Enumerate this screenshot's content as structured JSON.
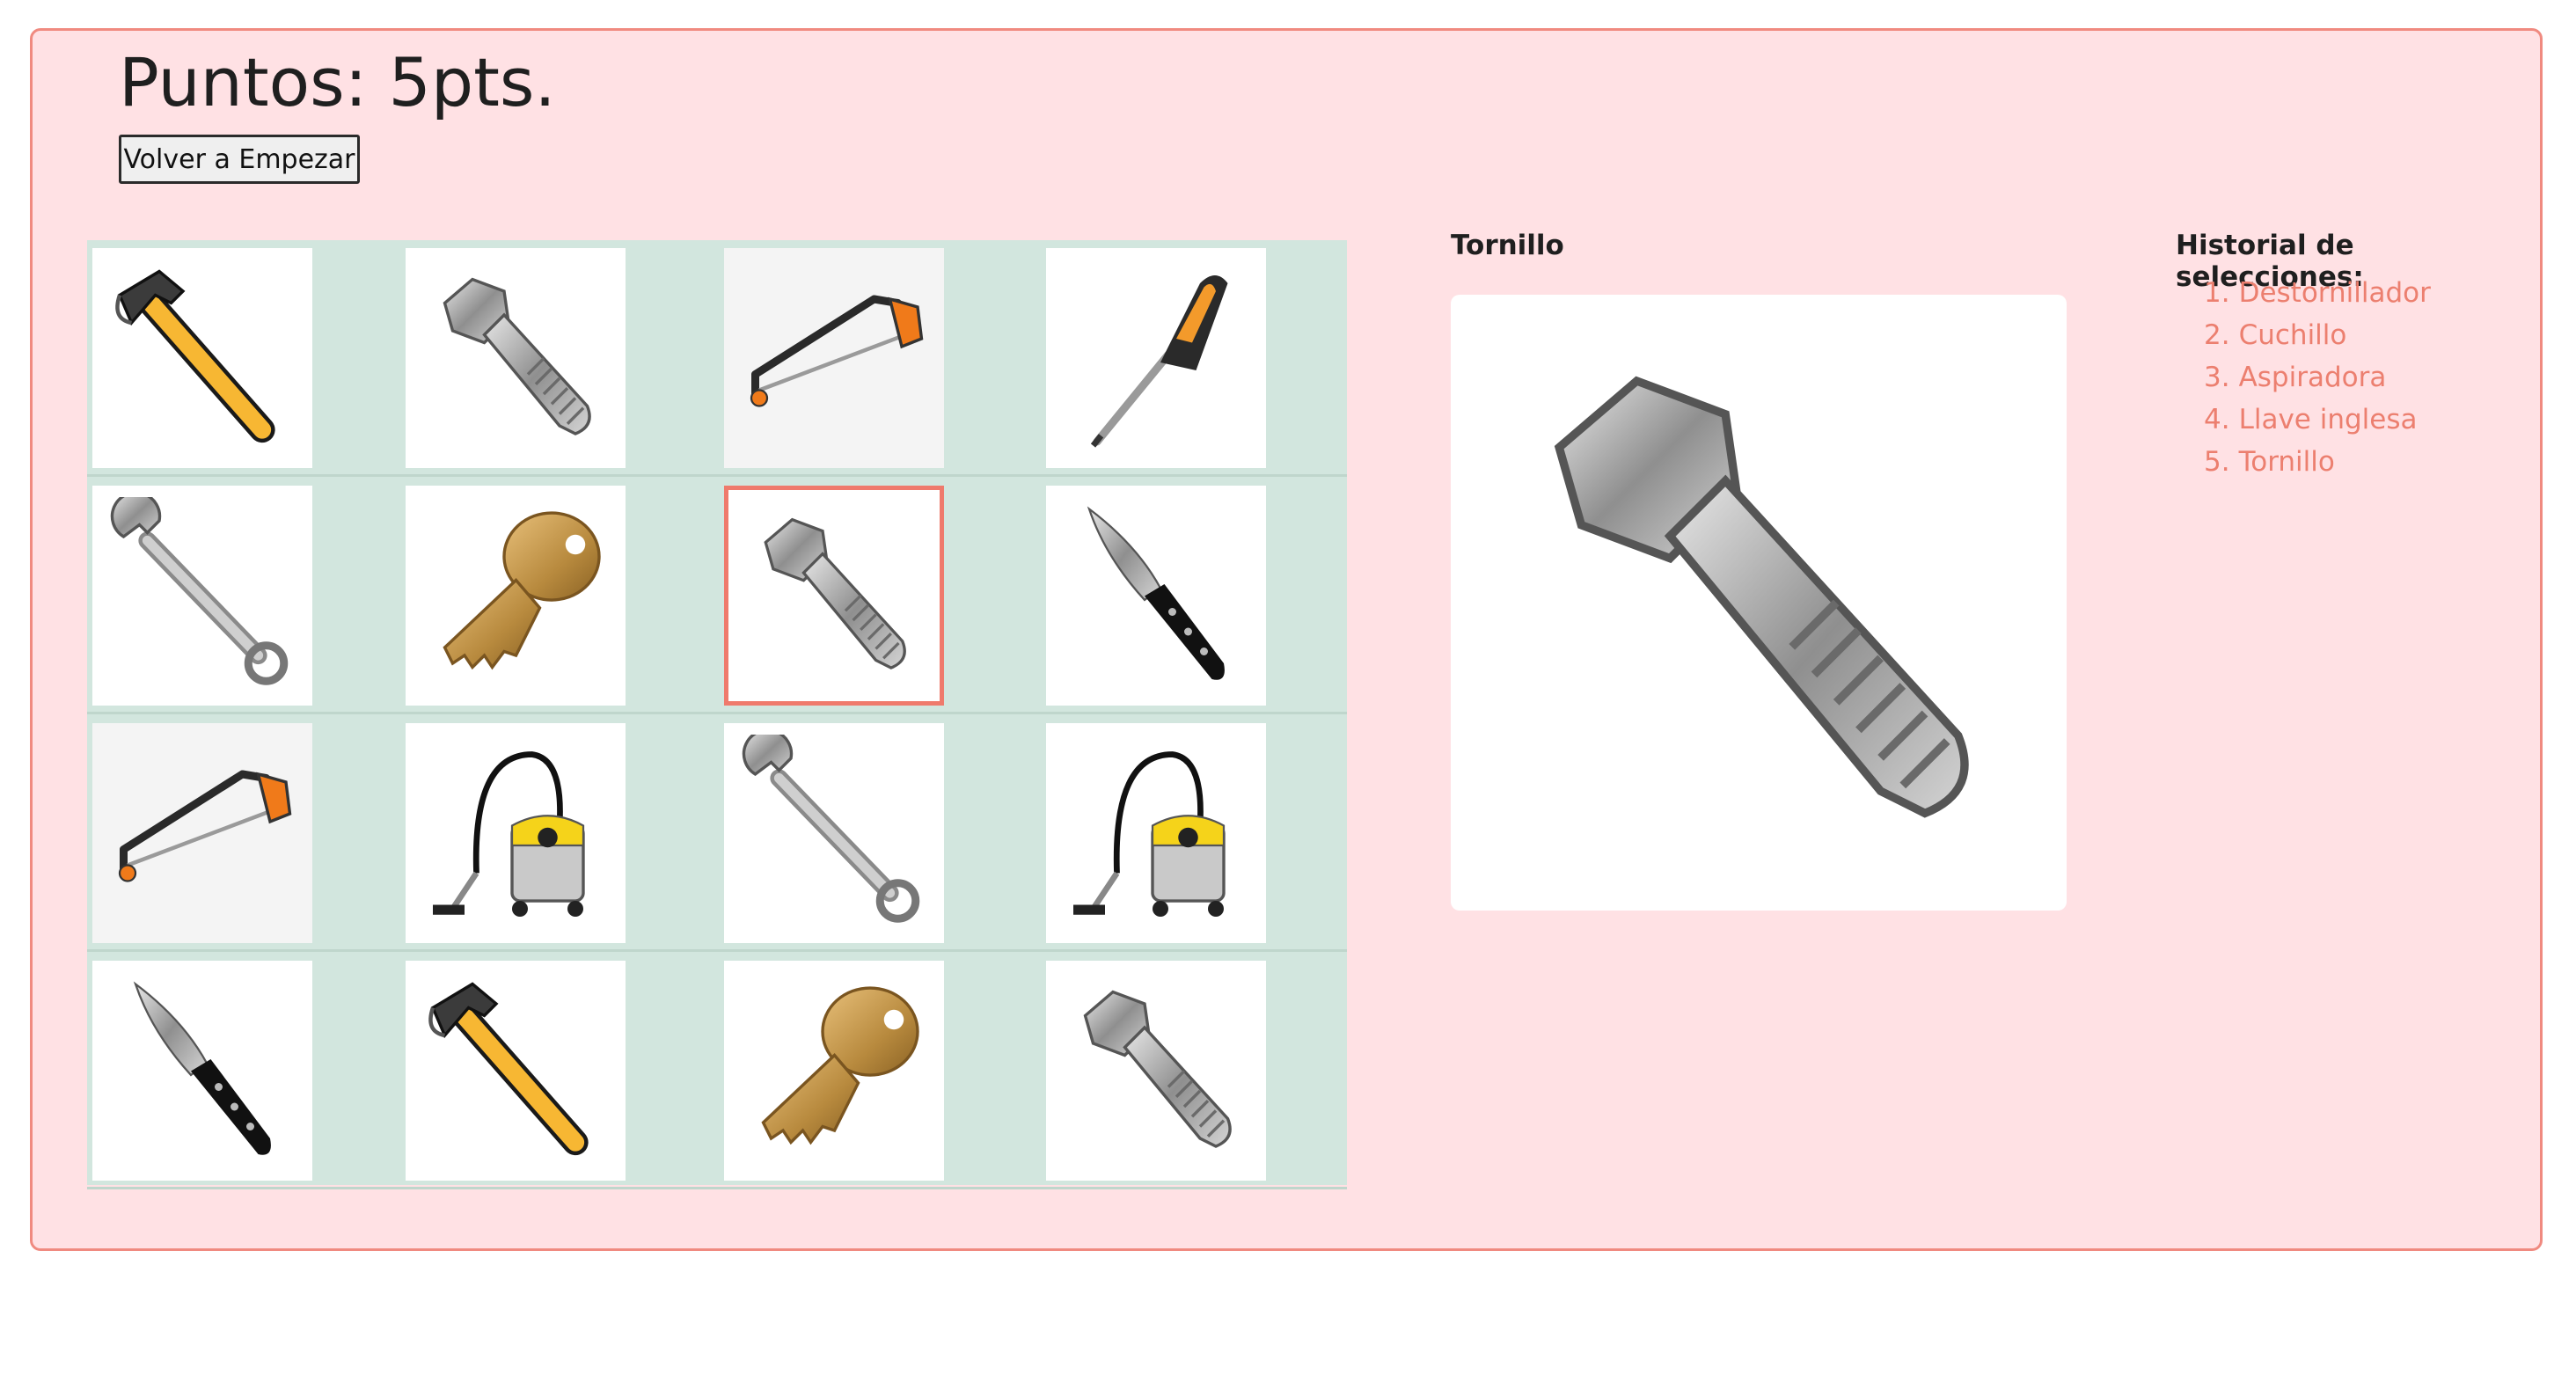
{
  "header": {
    "score_text": "Puntos: 5pts.",
    "reset_label": "Volver a Empezar"
  },
  "grid": {
    "rows": [
      [
        {
          "tool": "hammer-icon",
          "bg": "white"
        },
        {
          "tool": "bolt-icon",
          "bg": "white"
        },
        {
          "tool": "hacksaw-icon",
          "bg": "shaded"
        },
        {
          "tool": "screwdriver-icon",
          "bg": "white"
        }
      ],
      [
        {
          "tool": "wrench-icon",
          "bg": "white"
        },
        {
          "tool": "key-icon",
          "bg": "white"
        },
        {
          "tool": "bolt-icon",
          "bg": "white",
          "selected": true
        },
        {
          "tool": "knife-icon",
          "bg": "white"
        }
      ],
      [
        {
          "tool": "hacksaw-icon",
          "bg": "shaded"
        },
        {
          "tool": "vacuum-icon",
          "bg": "white"
        },
        {
          "tool": "wrench-icon",
          "bg": "white"
        },
        {
          "tool": "vacuum-icon",
          "bg": "white"
        }
      ],
      [
        {
          "tool": "knife-icon",
          "bg": "white"
        },
        {
          "tool": "hammer-icon",
          "bg": "white"
        },
        {
          "tool": "key-icon",
          "bg": "white"
        },
        {
          "tool": "bolt-icon",
          "bg": "white"
        }
      ]
    ]
  },
  "detail": {
    "title": "Tornillo",
    "image": "bolt-icon"
  },
  "history": {
    "title": "Historial de selecciones:",
    "items": [
      "Destornillador",
      "Cuchillo",
      "Aspiradora",
      "Llave inglesa",
      "Tornillo"
    ]
  },
  "colors": {
    "panel_bg": "#ffe1e4",
    "panel_border": "#f08a80",
    "grid_bg": "#d2e6de",
    "selected_border": "#ef7a6c",
    "history_text": "#ec7f6f"
  }
}
